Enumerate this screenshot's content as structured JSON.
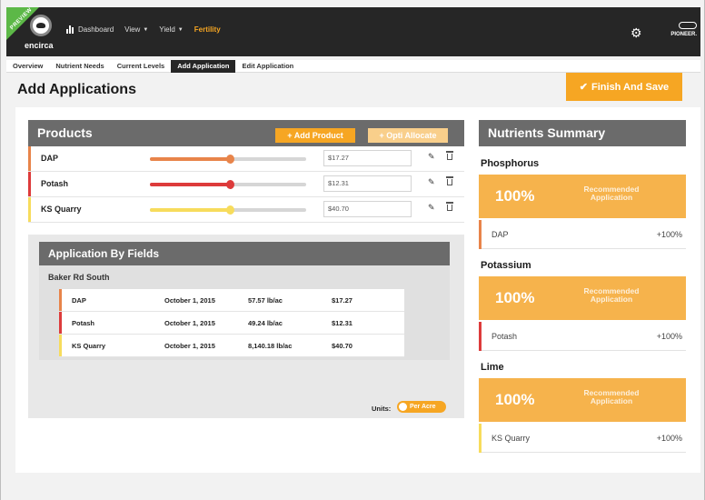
{
  "topbar": {
    "preview_label": "PREVIEW",
    "brand": "encirca",
    "nav": [
      {
        "label": "Dashboard",
        "caret": false,
        "active": false
      },
      {
        "label": "View",
        "caret": true,
        "active": false
      },
      {
        "label": "Yield",
        "caret": true,
        "active": false
      },
      {
        "label": "Fertility",
        "caret": false,
        "active": true
      }
    ],
    "partner_brand": "PIONEER."
  },
  "tabs": [
    {
      "label": "Overview",
      "active": false
    },
    {
      "label": "Nutrient Needs",
      "active": false
    },
    {
      "label": "Current Levels",
      "active": false
    },
    {
      "label": "Add Application",
      "active": true
    },
    {
      "label": "Edit Application",
      "active": false
    }
  ],
  "page": {
    "title": "Add Applications",
    "finish_button": "Finish And Save"
  },
  "products": {
    "title": "Products",
    "add_button": "+ Add Product",
    "opti_button": "+ Opti Allocate",
    "items": [
      {
        "name": "DAP",
        "cost": "$17.27",
        "level": 0.51,
        "color": "#e8844a"
      },
      {
        "name": "Potash",
        "cost": "$12.31",
        "level": 0.51,
        "color": "#dd3b3b"
      },
      {
        "name": "KS Quarry",
        "cost": "$40.70",
        "level": 0.51,
        "color": "#f7dc5c"
      }
    ]
  },
  "application_by_fields": {
    "title": "Application By Fields",
    "field_name": "Baker Rd South",
    "rows": [
      {
        "product": "DAP",
        "date": "October 1, 2015",
        "rate": "57.57 lb/ac",
        "cost": "$17.27",
        "color": "#e8844a"
      },
      {
        "product": "Potash",
        "date": "October 1, 2015",
        "rate": "49.24 lb/ac",
        "cost": "$12.31",
        "color": "#dd3b3b"
      },
      {
        "product": "KS Quarry",
        "date": "October 1, 2015",
        "rate": "8,140.18 lb/ac",
        "cost": "$40.70",
        "color": "#f7dc5c"
      }
    ],
    "units_label": "Units:",
    "units_value": "Per Acre"
  },
  "nutrients_summary": {
    "title": "Nutrients Summary",
    "sections": [
      {
        "name": "Phosphorus",
        "percent": "100%",
        "recommended": "Recommended Application",
        "product": "DAP",
        "value": "+100%",
        "color": "#e8844a"
      },
      {
        "name": "Potassium",
        "percent": "100%",
        "recommended": "Recommended Application",
        "product": "Potash",
        "value": "+100%",
        "color": "#dd3b3b"
      },
      {
        "name": "Lime",
        "percent": "100%",
        "recommended": "Recommended Application",
        "product": "KS Quarry",
        "value": "+100%",
        "color": "#f7dc5c"
      }
    ]
  }
}
